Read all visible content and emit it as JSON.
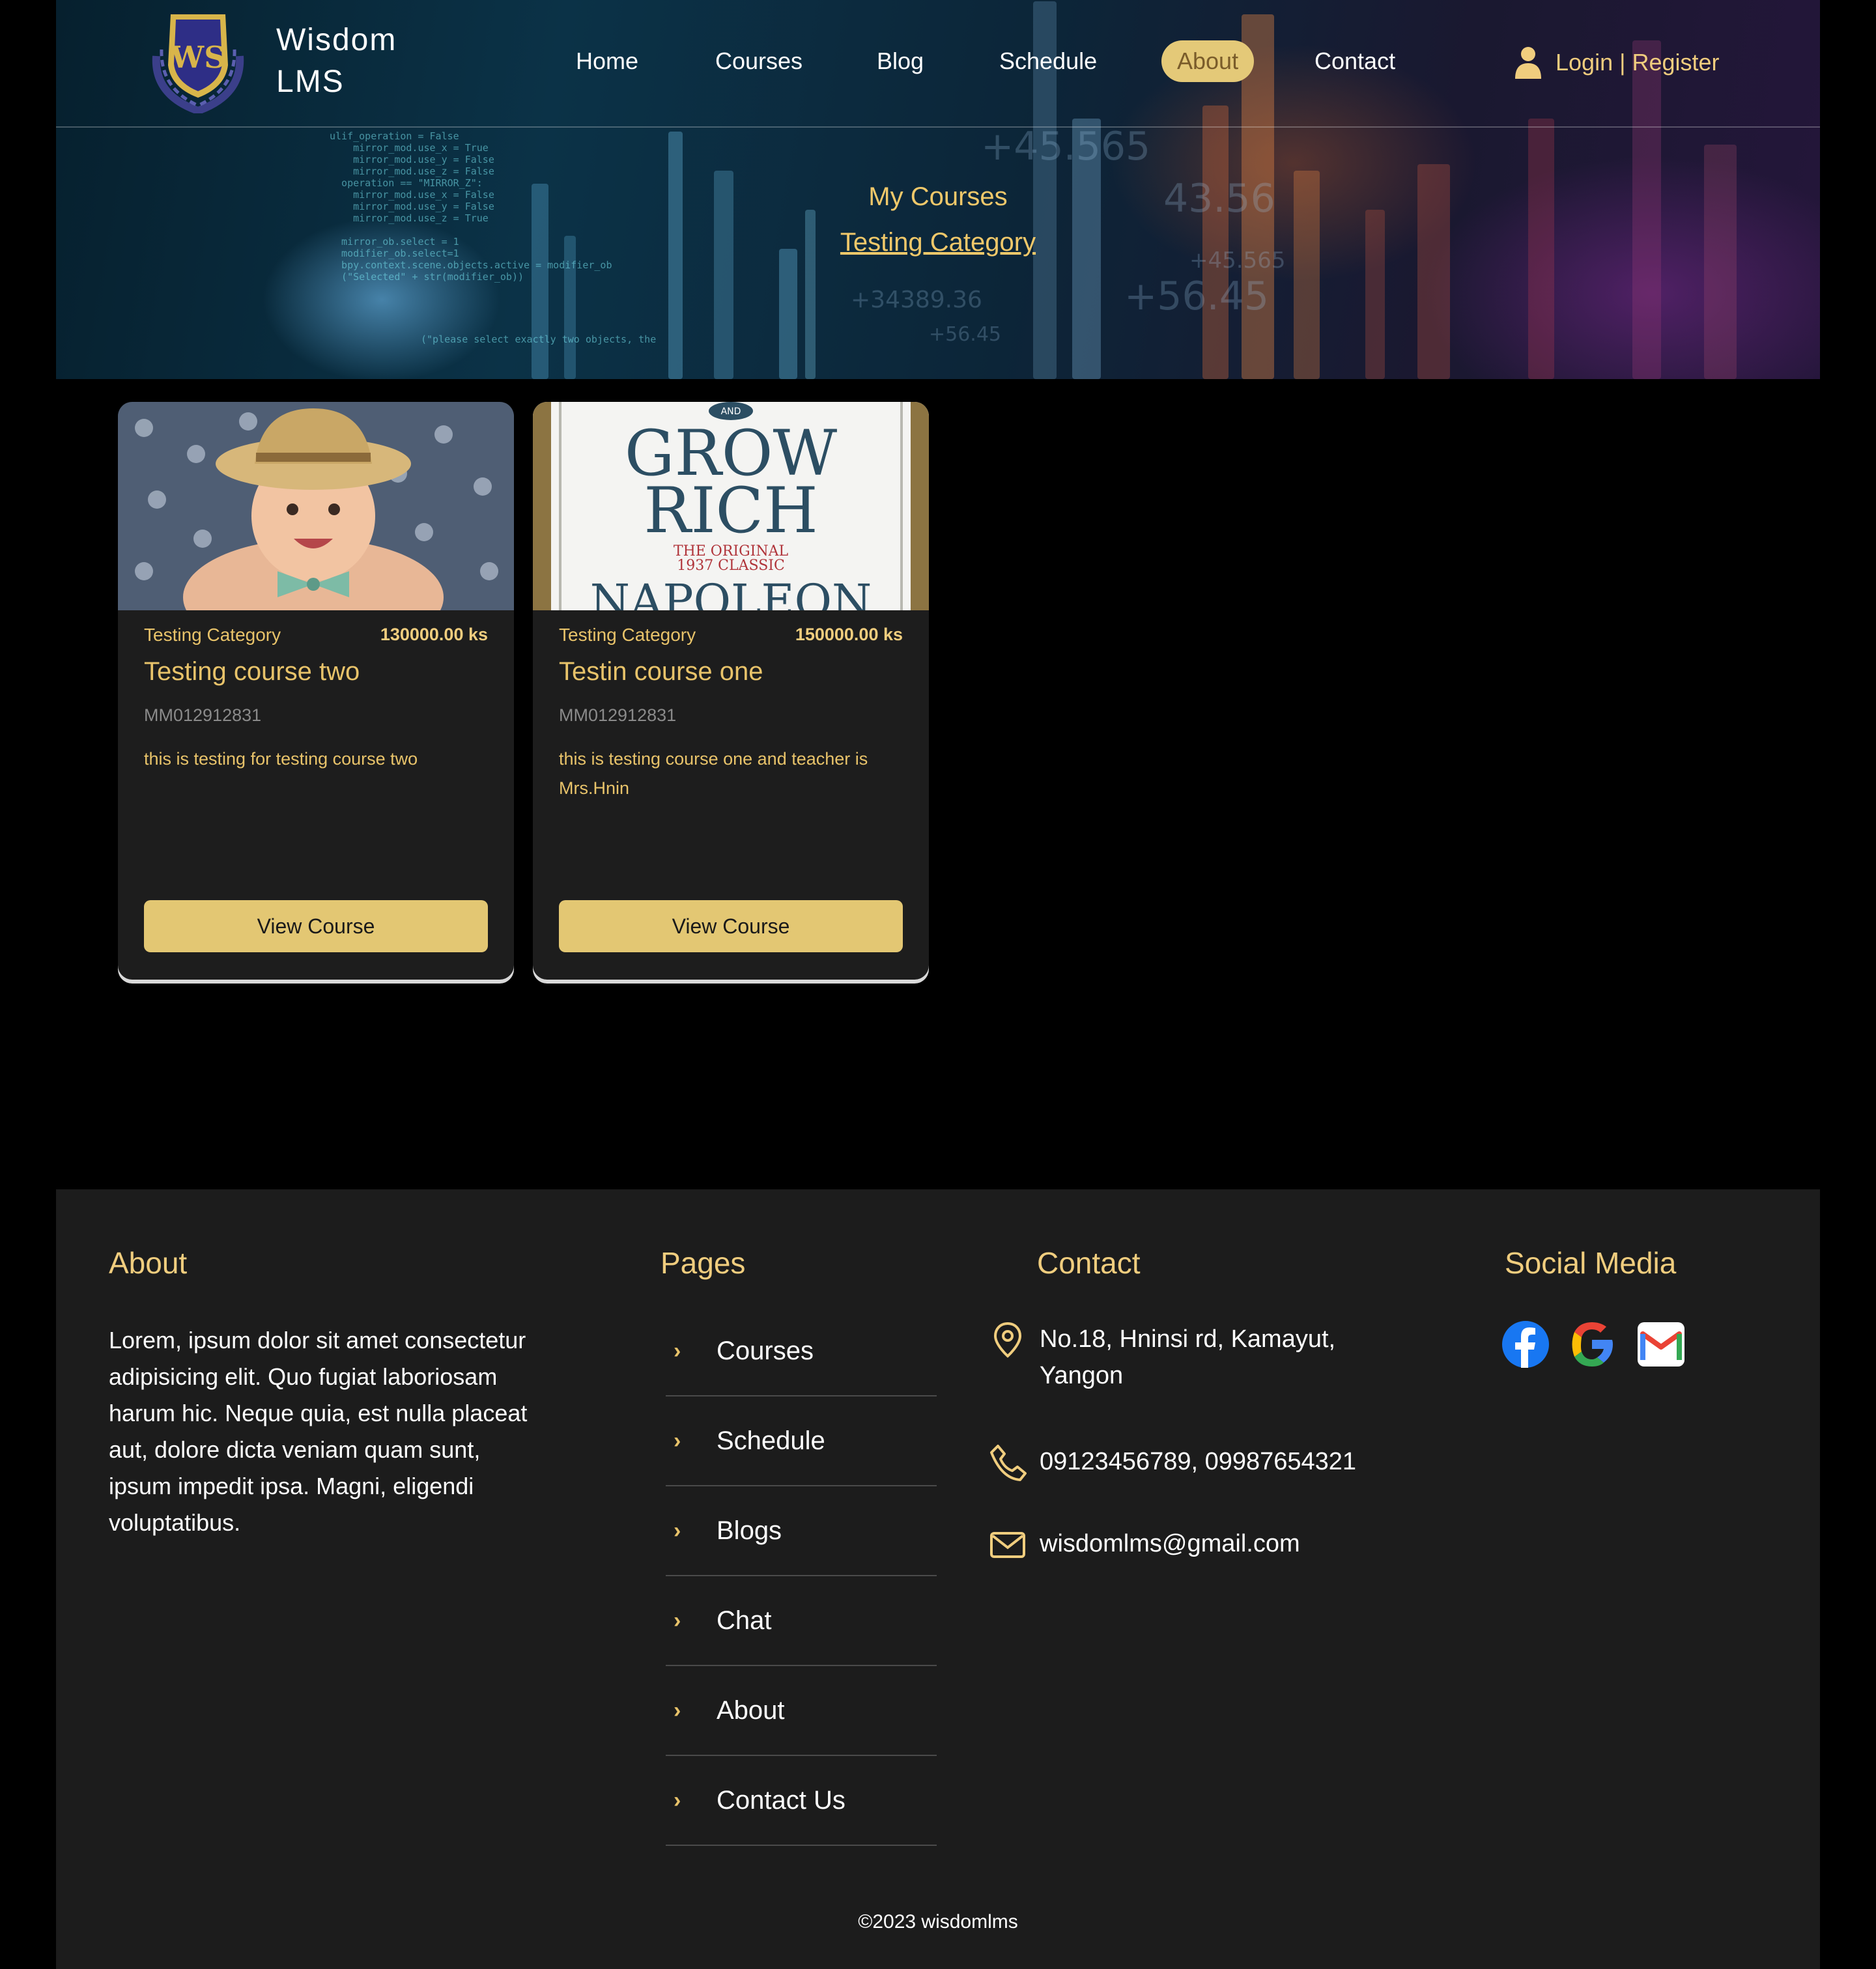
{
  "brand": {
    "name_line1": "Wisdom",
    "name_line2": "LMS",
    "logo_text": "WS"
  },
  "nav": {
    "items": [
      {
        "label": "Home"
      },
      {
        "label": "Courses"
      },
      {
        "label": "Blog"
      },
      {
        "label": "Schedule"
      },
      {
        "label": "About",
        "active": true
      },
      {
        "label": "Contact"
      }
    ],
    "login_label": "Login | Register"
  },
  "hero": {
    "title": "My Courses",
    "subtitle": "Testing Category"
  },
  "courses": [
    {
      "category": "Testing Category",
      "price": "130000.00 ks",
      "title": "Testing course two",
      "code": "MM012912831",
      "description": "this is testing for testing course two",
      "button": "View Course"
    },
    {
      "category": "Testing Category",
      "price": "150000.00 ks",
      "title": "Testin course one",
      "code": "MM012912831",
      "description": "this is testing course one and teacher is Mrs.Hnin",
      "button": "View Course",
      "cover_text": {
        "line1": "GROW",
        "line2": "RICH",
        "line3": "THE ORIGINAL",
        "line4": "1937 CLASSIC",
        "line5": "NAPOLEON",
        "top": "AND"
      }
    }
  ],
  "footer": {
    "about": {
      "heading": "About",
      "text": "Lorem, ipsum dolor sit amet consectetur adipisicing elit. Quo fugiat laboriosam harum hic. Neque quia, est nulla placeat aut, dolore dicta veniam quam sunt, ipsum impedit ipsa. Magni, eligendi voluptatibus."
    },
    "pages": {
      "heading": "Pages",
      "items": [
        "Courses",
        "Schedule",
        "Blogs",
        "Chat",
        "About",
        "Contact Us"
      ]
    },
    "contact": {
      "heading": "Contact",
      "address_line1": "No.18, Hninsi rd, Kamayut,",
      "address_line2": "Yangon",
      "phone": "09123456789, 09987654321",
      "email": "wisdomlms@gmail.com"
    },
    "social": {
      "heading": "Social Media",
      "icons": [
        "facebook-icon",
        "google-icon",
        "gmail-icon"
      ]
    },
    "copyright": "©2023 wisdomlms"
  },
  "colors": {
    "accent": "#f0cd7e",
    "button": "#e3c773",
    "card_bg": "#1d1d1d",
    "footer_bg": "#1c1c1c"
  }
}
